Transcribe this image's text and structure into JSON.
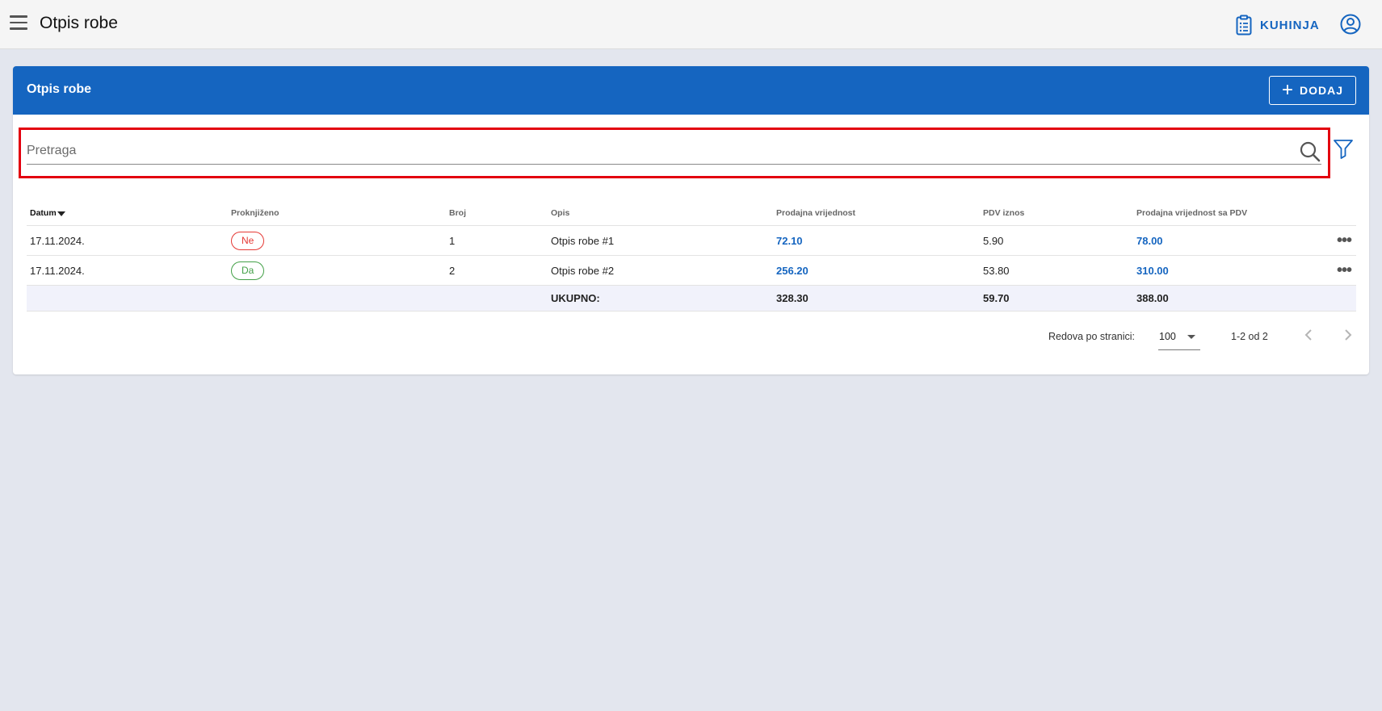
{
  "appbar": {
    "title": "Otpis robe",
    "kitchen_label": "KUHINJA",
    "icons": {
      "menu": "menu-icon",
      "kitchen": "clipboard-list-icon",
      "account": "account-circle-icon"
    }
  },
  "card": {
    "title": "Otpis robe",
    "add_label": "DODAJ",
    "add_icon": "plus-icon",
    "accent_color": "#1565c0"
  },
  "search": {
    "placeholder": "Pretraga",
    "value": "",
    "icon": "search-icon",
    "filter_icon": "filter-icon",
    "highlight_color": "#e3000f"
  },
  "table": {
    "columns": [
      "Datum",
      "Proknjiženo",
      "Broj",
      "Opis",
      "Prodajna vrijednost",
      "PDV iznos",
      "Prodajna vrijednost sa PDV"
    ],
    "sorted_column": "Datum",
    "sort_direction": "descending",
    "rows": [
      {
        "datum": "17.11.2024.",
        "proknjizeno": "Ne",
        "broj": "1",
        "opis": "Otpis robe #1",
        "prodajna": "72.10",
        "pdv": "5.90",
        "sa_pdv": "78.00"
      },
      {
        "datum": "17.11.2024.",
        "proknjizeno": "Da",
        "broj": "2",
        "opis": "Otpis robe #2",
        "prodajna": "256.20",
        "pdv": "53.80",
        "sa_pdv": "310.00"
      }
    ],
    "total": {
      "label": "UKUPNO:",
      "prodajna": "328.30",
      "pdv": "59.70",
      "sa_pdv": "388.00"
    },
    "status_colors": {
      "Ne": "#e53935",
      "Da": "#43a047"
    }
  },
  "pagination": {
    "rows_per_page_label": "Redova po stranici:",
    "rows_per_page": "100",
    "range": "1-2 od 2"
  }
}
